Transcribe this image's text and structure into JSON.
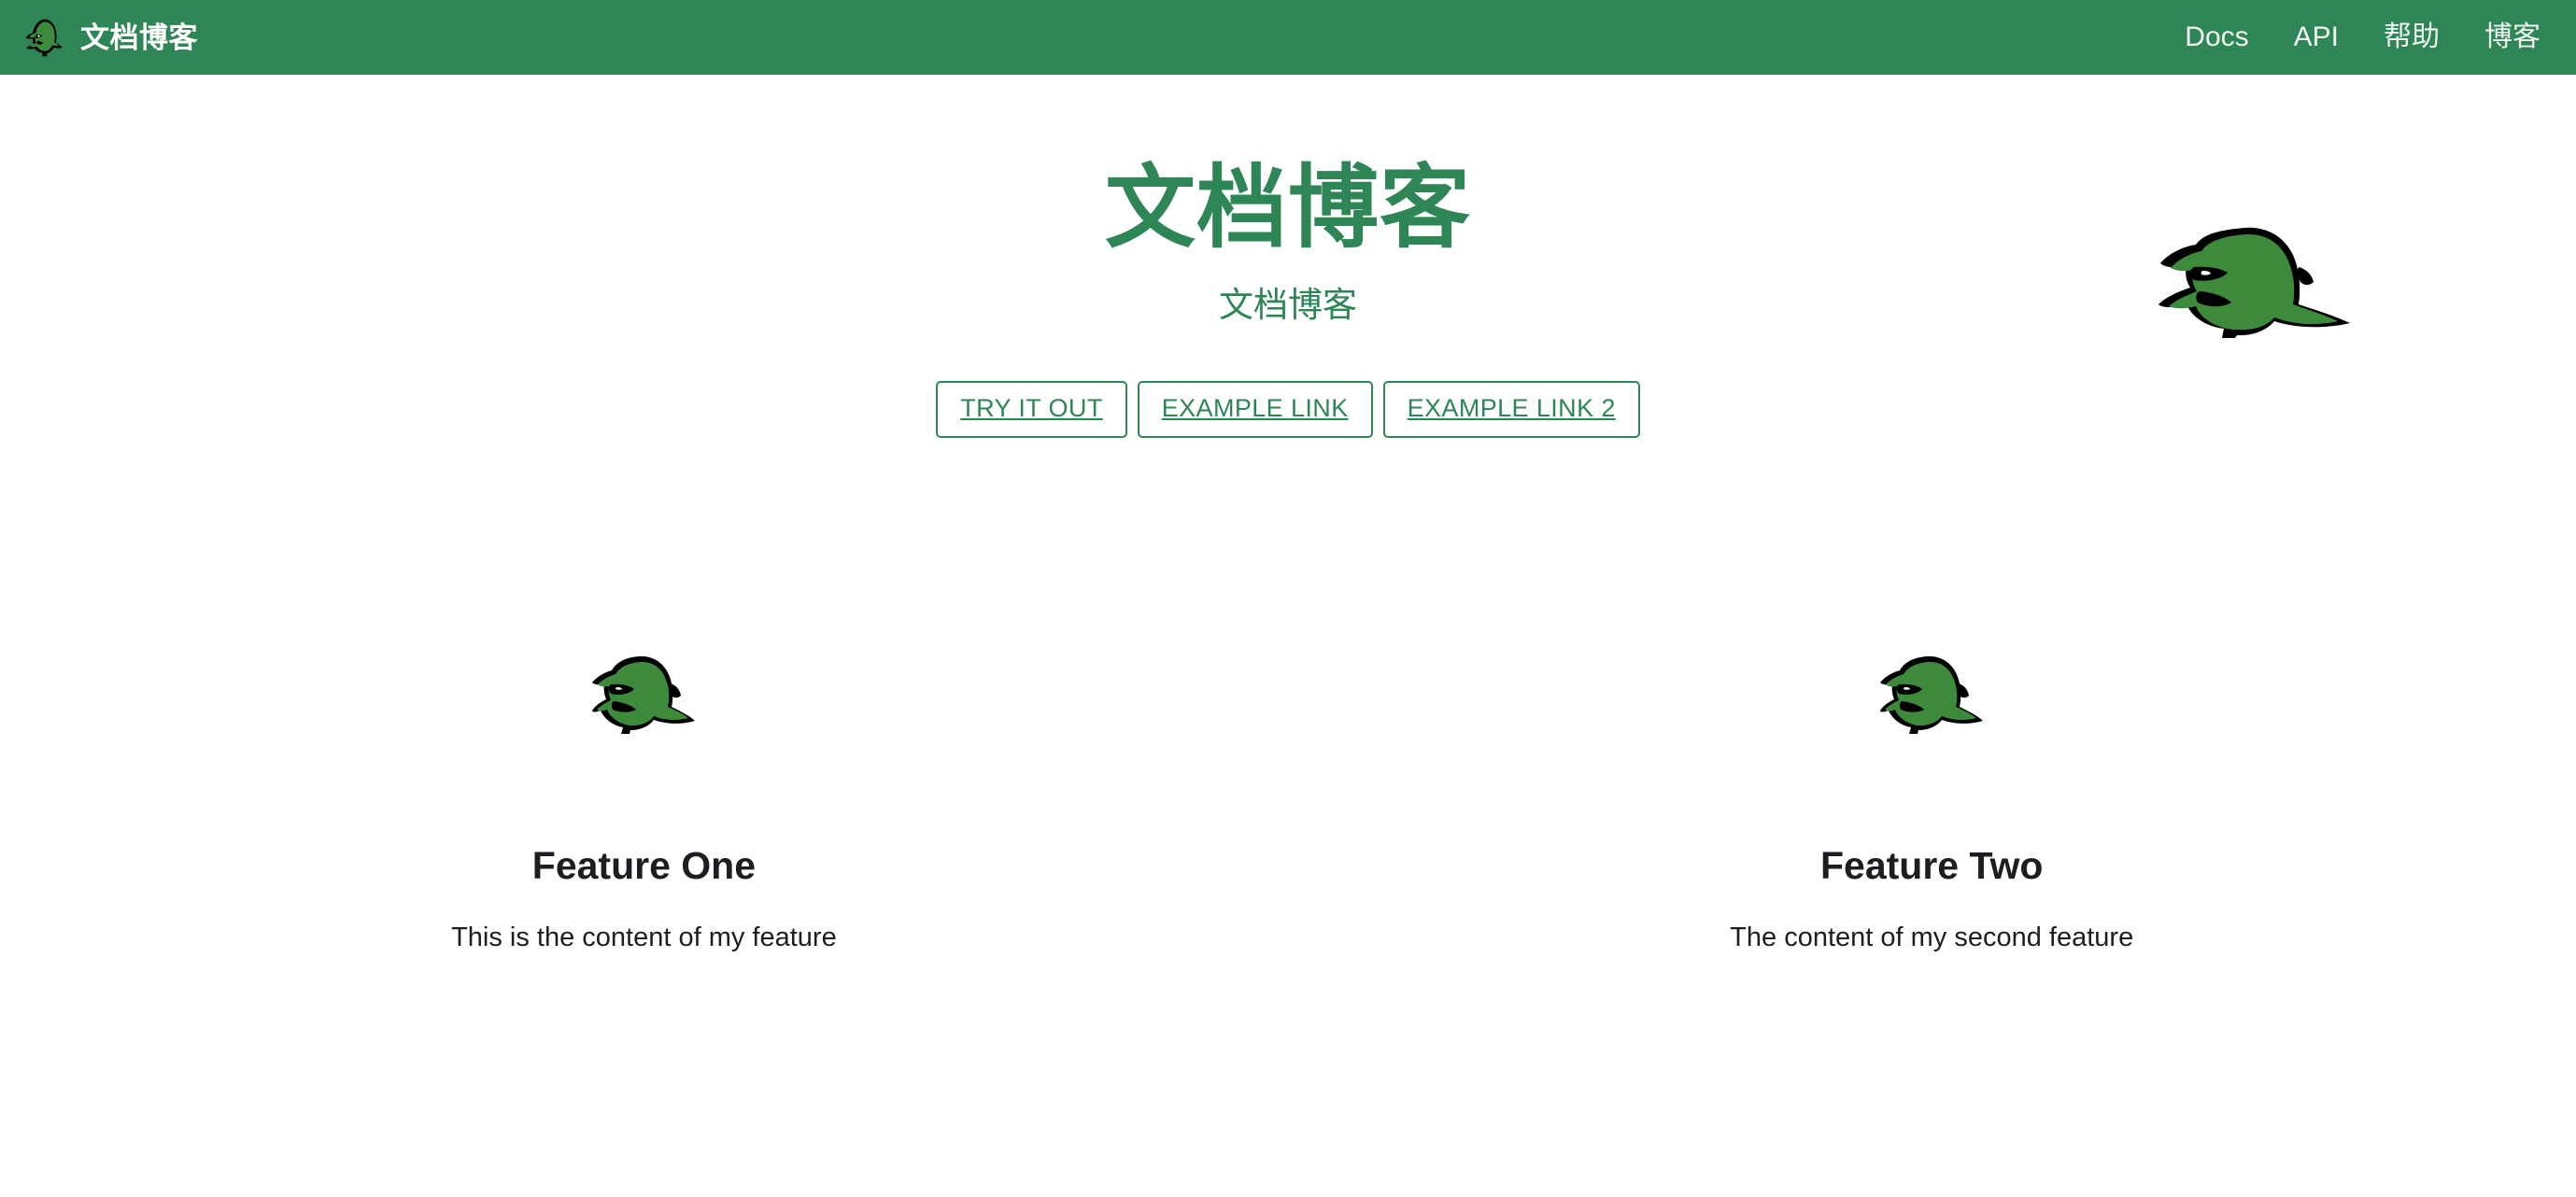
{
  "navbar": {
    "logo_icon": "dinosaur-logo-icon",
    "title": "文档博客",
    "links": [
      {
        "label": "Docs",
        "name": "nav-link-docs"
      },
      {
        "label": "API",
        "name": "nav-link-api"
      },
      {
        "label": "帮助",
        "name": "nav-link-help"
      },
      {
        "label": "博客",
        "name": "nav-link-blog"
      }
    ],
    "background_color": "#2e8555",
    "text_color": "#ffffff"
  },
  "hero": {
    "title": "文档博客",
    "subtitle": "文档博客",
    "accent_color": "#2e8555",
    "dino_icon": "dinosaur-illustration-icon",
    "buttons": [
      {
        "label": "TRY IT OUT",
        "name": "try-it-out-button"
      },
      {
        "label": "EXAMPLE LINK",
        "name": "example-link-button"
      },
      {
        "label": "EXAMPLE LINK 2",
        "name": "example-link-2-button"
      }
    ]
  },
  "features": [
    {
      "icon": "dinosaur-feature-icon",
      "heading": "Feature One",
      "text": "This is the content of my feature"
    },
    {
      "icon": "dinosaur-feature-icon",
      "heading": "Feature Two",
      "text": "The content of my second feature"
    }
  ]
}
